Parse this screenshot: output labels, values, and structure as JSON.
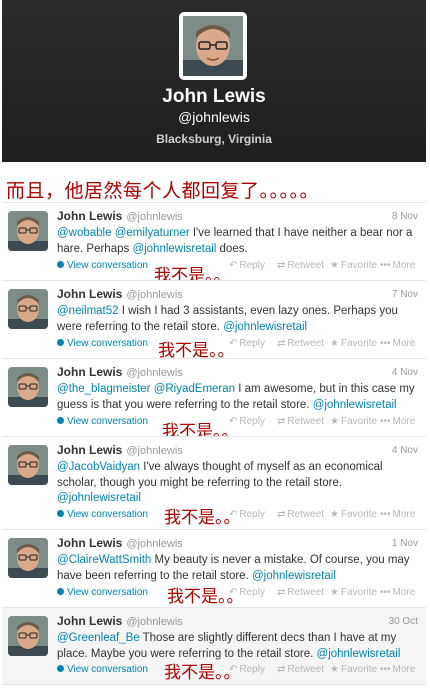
{
  "profile": {
    "name": "John Lewis",
    "handle": "@johnlewis",
    "location": "Blacksburg, Virginia"
  },
  "caption": "而且，他居然每个人都回复了。。。。。",
  "overlay_text": "我不是。。",
  "actions": {
    "view_conversation": "View conversation",
    "reply": "Reply",
    "retweet": "Retweet",
    "favorite": "Favorite",
    "more": "More"
  },
  "tweets": [
    {
      "name": "John Lewis",
      "handle": "@johnlewis",
      "date": "8 Nov",
      "parts": [
        {
          "t": "@wobable",
          "m": true
        },
        {
          "t": " "
        },
        {
          "t": "@emilyaturner",
          "m": true
        },
        {
          "t": " I've learned that I have neither a bear nor a hare. Perhaps "
        },
        {
          "t": "@johnlewisretail",
          "m": true
        },
        {
          "t": " does."
        }
      ]
    },
    {
      "name": "John Lewis",
      "handle": "@johnlewis",
      "date": "7 Nov",
      "parts": [
        {
          "t": "@neilmat52",
          "m": true
        },
        {
          "t": " I wish I had 3 assistants, even lazy ones. Perhaps you were referring to the retail store. "
        },
        {
          "t": "@johnlewisretail",
          "m": true
        }
      ]
    },
    {
      "name": "John Lewis",
      "handle": "@johnlewis",
      "date": "4 Nov",
      "parts": [
        {
          "t": "@the_blagmeister",
          "m": true
        },
        {
          "t": " "
        },
        {
          "t": "@RiyadEmeran",
          "m": true
        },
        {
          "t": " I am awesome, but in this case my guess is that you were referring to the retail store. "
        },
        {
          "t": "@johnlewisretail",
          "m": true
        }
      ]
    },
    {
      "name": "John Lewis",
      "handle": "@johnlewis",
      "date": "4 Nov",
      "parts": [
        {
          "t": "@JacobVaidyan",
          "m": true
        },
        {
          "t": " I've always thought of myself as an economical scholar, though you might be referring to the retail store. "
        },
        {
          "t": "@johnlewisretail",
          "m": true
        }
      ]
    },
    {
      "name": "John Lewis",
      "handle": "@johnlewis",
      "date": "1 Nov",
      "parts": [
        {
          "t": "@ClaireWattSmith",
          "m": true
        },
        {
          "t": "  My beauty is never a mistake. Of course, you may have been referring to the retail store. "
        },
        {
          "t": "@johnlewisretail",
          "m": true
        }
      ]
    },
    {
      "name": "John Lewis",
      "handle": "@johnlewis",
      "date": "30 Oct",
      "parts": [
        {
          "t": "@Greenleaf_Be",
          "m": true
        },
        {
          "t": "  Those are slightly different decs than I have at my place. Maybe you were referring to the retail store. "
        },
        {
          "t": "@johnlewisretail",
          "m": true
        }
      ]
    }
  ]
}
